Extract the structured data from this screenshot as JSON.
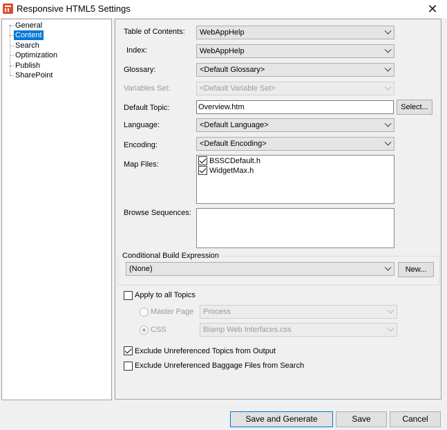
{
  "window": {
    "title": "Responsive HTML5 Settings"
  },
  "tree": {
    "items": [
      {
        "label": "General",
        "selected": false
      },
      {
        "label": "Content",
        "selected": true
      },
      {
        "label": "Search",
        "selected": false
      },
      {
        "label": "Optimization",
        "selected": false
      },
      {
        "label": "Publish",
        "selected": false
      },
      {
        "label": "SharePoint",
        "selected": false
      }
    ]
  },
  "content": {
    "toc": {
      "label": "Table of Contents:",
      "value": "WebAppHelp"
    },
    "index": {
      "label": "Index:",
      "value": "WebAppHelp"
    },
    "glossary": {
      "label": "Glossary:",
      "value": "<Default Glossary>"
    },
    "variables_set": {
      "label": "Variables Set:",
      "value": "<Default Variable Set>"
    },
    "default_topic": {
      "label": "Default Topic:",
      "value": "Overview.htm",
      "button": "Select..."
    },
    "language": {
      "label": "Language:",
      "value": "<Default Language>"
    },
    "encoding": {
      "label": "Encoding:",
      "value": "<Default Encoding>"
    },
    "map_files": {
      "label": "Map Files:",
      "items": [
        {
          "name": "BSSCDefault.h",
          "checked": true
        },
        {
          "name": "WidgetMax.h",
          "checked": true
        }
      ]
    },
    "browse_sequences": {
      "label": "Browse Sequences:"
    },
    "conditional_build": {
      "label": "Conditional Build Expression",
      "value": "(None)",
      "button": "New..."
    },
    "apply_all_topics": {
      "label": "Apply to all Topics",
      "checked": false
    },
    "master_page": {
      "label": "Master Page",
      "value": "Process"
    },
    "css": {
      "label": "CSS",
      "value": "Biamp Web Interfaces.css"
    },
    "exclude_topics": {
      "label": "Exclude Unreferenced Topics from Output",
      "checked": true
    },
    "exclude_baggage": {
      "label": "Exclude Unreferenced Baggage Files from Search",
      "checked": false
    }
  },
  "footer": {
    "save_generate": "Save and Generate",
    "save": "Save",
    "cancel": "Cancel"
  }
}
